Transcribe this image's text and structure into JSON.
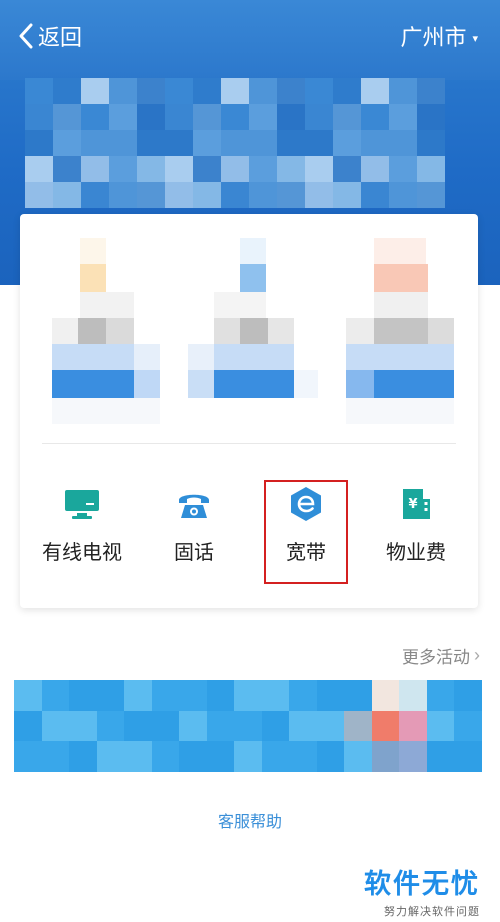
{
  "nav": {
    "back_label": "返回",
    "city_label": "广州市",
    "city_caret": "▾"
  },
  "services": [
    {
      "label": "有线电视",
      "icon": "tv-icon",
      "color": "#1aa79c"
    },
    {
      "label": "固话",
      "icon": "telephone-icon",
      "color": "#2f8ed8"
    },
    {
      "label": "宽带",
      "icon": "broadband-e-icon",
      "color": "#2f8ed8"
    },
    {
      "label": "物业费",
      "icon": "property-fee-icon",
      "color": "#1aa79c"
    }
  ],
  "more_activities": "更多活动",
  "more_arrow": "›",
  "help_label": "客服帮助",
  "watermark": {
    "brand": "软件无忧",
    "slogan": "努力解决软件问题"
  },
  "colors": {
    "header_blue": "#1f6bc6",
    "highlight_red": "#d42020",
    "link_blue": "#3a8fd8"
  }
}
